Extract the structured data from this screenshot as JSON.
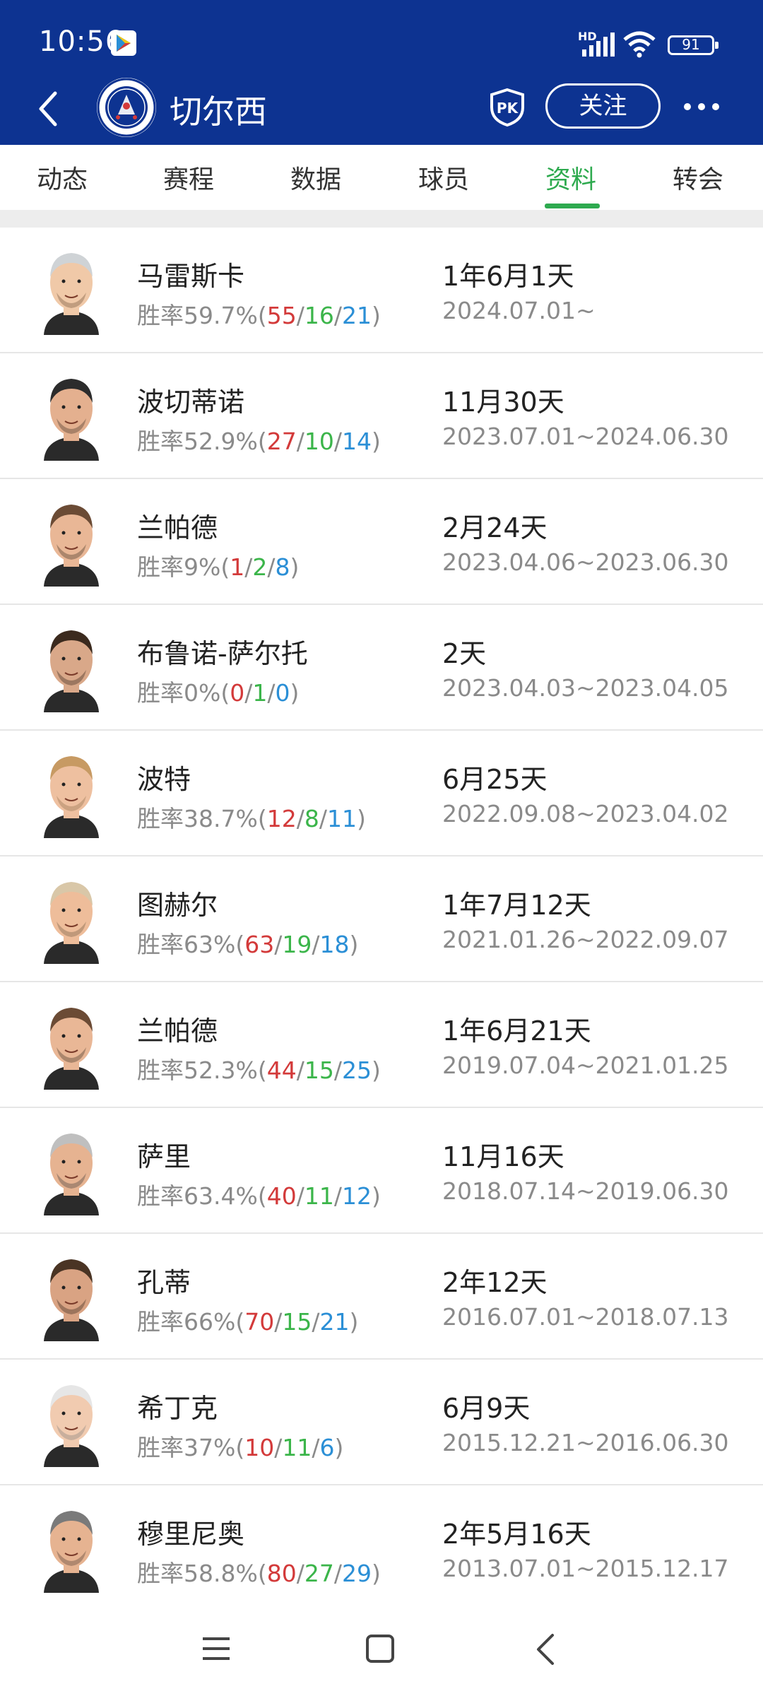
{
  "status_bar": {
    "time": "10:56",
    "hd_label": "HD",
    "battery": "91"
  },
  "header": {
    "club_name": "切尔西",
    "pk_label": "PK",
    "follow_label": "关注"
  },
  "tabs": [
    {
      "label": "动态",
      "active": false
    },
    {
      "label": "赛程",
      "active": false
    },
    {
      "label": "数据",
      "active": false
    },
    {
      "label": "球员",
      "active": false
    },
    {
      "label": "资料",
      "active": true
    },
    {
      "label": "转会",
      "active": false
    }
  ],
  "colors": {
    "header_bg": "#0d3391",
    "accent": "#2eaa4f",
    "win": "#d33a3a",
    "draw": "#3bb54a",
    "loss": "#2b8fd6"
  },
  "coaches": [
    {
      "name": "马雷斯卡",
      "win_rate": "胜率59.7%",
      "w": "55",
      "d": "16",
      "l": "21",
      "tenure": "1年6月1天",
      "period": "2024.07.01~"
    },
    {
      "name": "波切蒂诺",
      "win_rate": "胜率52.9%",
      "w": "27",
      "d": "10",
      "l": "14",
      "tenure": "11月30天",
      "period": "2023.07.01~2024.06.30"
    },
    {
      "name": "兰帕德",
      "win_rate": "胜率9%",
      "w": "1",
      "d": "2",
      "l": "8",
      "tenure": "2月24天",
      "period": "2023.04.06~2023.06.30"
    },
    {
      "name": "布鲁诺-萨尔托",
      "win_rate": "胜率0%",
      "w": "0",
      "d": "1",
      "l": "0",
      "tenure": "2天",
      "period": "2023.04.03~2023.04.05"
    },
    {
      "name": "波特",
      "win_rate": "胜率38.7%",
      "w": "12",
      "d": "8",
      "l": "11",
      "tenure": "6月25天",
      "period": "2022.09.08~2023.04.02"
    },
    {
      "name": "图赫尔",
      "win_rate": "胜率63%",
      "w": "63",
      "d": "19",
      "l": "18",
      "tenure": "1年7月12天",
      "period": "2021.01.26~2022.09.07"
    },
    {
      "name": "兰帕德",
      "win_rate": "胜率52.3%",
      "w": "44",
      "d": "15",
      "l": "25",
      "tenure": "1年6月21天",
      "period": "2019.07.04~2021.01.25"
    },
    {
      "name": "萨里",
      "win_rate": "胜率63.4%",
      "w": "40",
      "d": "11",
      "l": "12",
      "tenure": "11月16天",
      "period": "2018.07.14~2019.06.30"
    },
    {
      "name": "孔蒂",
      "win_rate": "胜率66%",
      "w": "70",
      "d": "15",
      "l": "21",
      "tenure": "2年12天",
      "period": "2016.07.01~2018.07.13"
    },
    {
      "name": "希丁克",
      "win_rate": "胜率37%",
      "w": "10",
      "d": "11",
      "l": "6",
      "tenure": "6月9天",
      "period": "2015.12.21~2016.06.30"
    },
    {
      "name": "穆里尼奥",
      "win_rate": "胜率58.8%",
      "w": "80",
      "d": "27",
      "l": "29",
      "tenure": "2年5月16天",
      "period": "2013.07.01~2015.12.17"
    }
  ]
}
